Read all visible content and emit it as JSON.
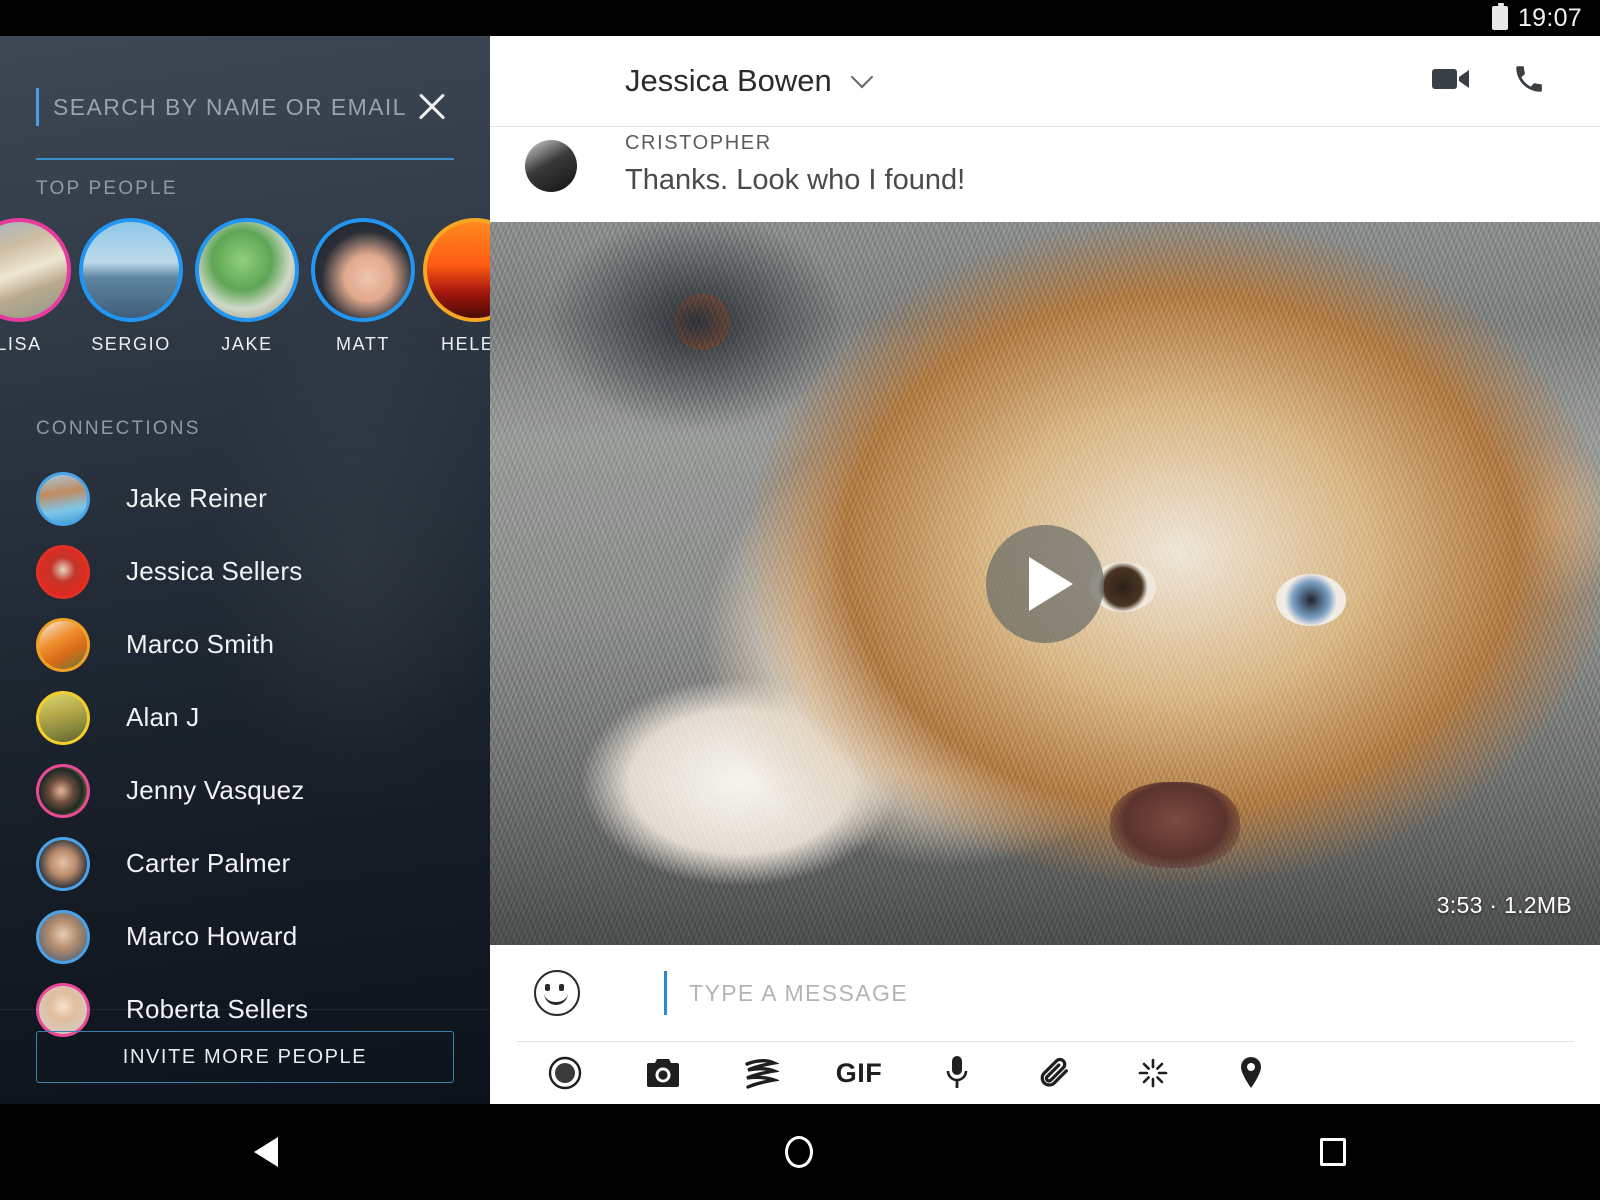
{
  "status_bar": {
    "time": "19:07",
    "battery_icon": "battery-full-icon"
  },
  "sidebar": {
    "search": {
      "placeholder": "SEARCH BY NAME OR EMAIL",
      "value": "",
      "close_icon": "close-icon"
    },
    "top_people_label": "TOP PEOPLE",
    "top_people": [
      {
        "name": "LISA",
        "ring_color": "#e8399e",
        "photo": "car-street-photo"
      },
      {
        "name": "SERGIO",
        "ring_color": "#2196f3",
        "photo": "sailboats-photo"
      },
      {
        "name": "JAKE",
        "ring_color": "#2196f3",
        "photo": "green-plant-photo"
      },
      {
        "name": "MATT",
        "ring_color": "#2196f3",
        "photo": "woman-black-hat-photo"
      },
      {
        "name": "HELEN",
        "ring_color": "#f5a623",
        "photo": "sunset-pier-photo"
      }
    ],
    "connections_label": "CONNECTIONS",
    "connections": [
      {
        "name": "Jake Reiner",
        "ring_color": "#4aa3e8",
        "photo": "house-pool-photo"
      },
      {
        "name": "Jessica Sellers",
        "ring_color": "#e03127",
        "photo": "red-cartoon-photo"
      },
      {
        "name": "Marco Smith",
        "ring_color": "#f0a125",
        "photo": "carrots-food-photo"
      },
      {
        "name": "Alan J",
        "ring_color": "#f2cf2a",
        "photo": "field-landscape-photo"
      },
      {
        "name": "Jenny Vasquez",
        "ring_color": "#ec4899",
        "photo": "woman-dark-hair-photo"
      },
      {
        "name": "Carter Palmer",
        "ring_color": "#4aa3e8",
        "photo": "young-man-photo"
      },
      {
        "name": "Marco Howard",
        "ring_color": "#4aa3e8",
        "photo": "man-suit-photo"
      },
      {
        "name": "Roberta Sellers",
        "ring_color": "#ec4899",
        "photo": "blonde-woman-photo"
      }
    ],
    "invite_button": "INVITE MORE PEOPLE"
  },
  "chat": {
    "header": {
      "title": "Jessica Bowen",
      "chevron_icon": "chevron-down-icon",
      "video_call_icon": "video-camera-icon",
      "voice_call_icon": "phone-icon"
    },
    "message": {
      "sender": "CRISTOPHER",
      "text": "Thanks. Look who I found!",
      "avatar": "contact-avatar"
    },
    "video": {
      "play_icon": "play-icon",
      "duration": "3:53",
      "size": "1.2MB",
      "meta": "3:53 · 1.2MB",
      "content": "puppy-on-rug-video"
    },
    "composer": {
      "emoji_icon": "emoji-smiley-icon",
      "placeholder": "TYPE A MESSAGE",
      "value": "",
      "tools": [
        {
          "name": "record-icon",
          "label": ""
        },
        {
          "name": "camera-icon",
          "label": ""
        },
        {
          "name": "doodle-icon",
          "label": ""
        },
        {
          "name": "gif-icon",
          "label": "GIF"
        },
        {
          "name": "microphone-icon",
          "label": ""
        },
        {
          "name": "attachment-icon",
          "label": ""
        },
        {
          "name": "sparkle-icon",
          "label": ""
        },
        {
          "name": "location-icon",
          "label": ""
        }
      ]
    }
  },
  "nav_bar": {
    "back_icon": "back-triangle-icon",
    "home_icon": "home-circle-icon",
    "recents_icon": "recents-square-icon"
  },
  "colors": {
    "accent_blue": "#2e86d6",
    "sidebar_top": "#3e4854",
    "sidebar_bottom": "#0d131b"
  }
}
